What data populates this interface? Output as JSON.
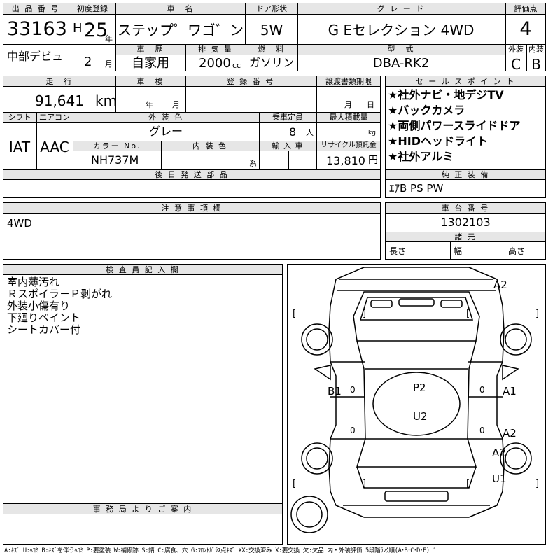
{
  "header": {
    "lot_label": "出 品 番 号",
    "lot_number": "33163",
    "debut_label": "中部デビュ",
    "first_reg_label": "初度登録",
    "era": "H",
    "year": "25",
    "year_unit": "年",
    "month": "2",
    "month_unit": "月",
    "car_name_label": "車　名",
    "car_name": "ステップ゜ワゴ゛ン",
    "door_label": "ドア形状",
    "door": "5W",
    "grade_label": "グ レ ー ド",
    "grade": "G Eセレクション 4WD",
    "score_label": "評価点",
    "score": "4",
    "history_label": "車　歴",
    "history": "自家用",
    "displacement_label": "排 気 量",
    "displacement": "2000",
    "cc": "cc",
    "fuel_label": "燃　料",
    "fuel": "ガソリン",
    "model_label": "型　式",
    "model": "DBA-RK2",
    "exterior_label": "外装",
    "exterior_grade": "C",
    "interior_label": "内装",
    "interior_grade": "B"
  },
  "spec": {
    "mileage_label": "走　行",
    "mileage": "91,641",
    "km": "km",
    "inspection_label": "車　検",
    "year_unit": "年",
    "month_unit": "月",
    "reg_number_label": "登 録 番 号",
    "transfer_label": "譲渡書類期限",
    "shift_label": "シフト",
    "ac_label": "エアコン",
    "shift": "IAT",
    "ac": "AAC",
    "exterior_color_label": "外 装 色",
    "exterior_color": "グレー",
    "capacity_label": "乗車定員",
    "capacity": "8",
    "capacity_unit": "人",
    "max_load_label": "最大積載量",
    "kg": "kg",
    "color_no_label": "カラー No.",
    "color_no": "NH737M",
    "interior_color_label": "内 装 色",
    "interior_suffix": "系",
    "import_label": "輸 入 車",
    "recycle_label": "リサイクル預託金",
    "recycle_fee": "13,810",
    "yen": "円",
    "later_parts_label": "後 日 発 送 部 品"
  },
  "sales_points": {
    "label": "セ ー ル ス ポ イ ン ト",
    "items": [
      "★社外ナビ・地デジTV",
      "★バックカメラ",
      "★両側パワースライドドア",
      "★HIDヘッドライト",
      "★社外アルミ"
    ]
  },
  "equipment": {
    "label": "純 正 装 備",
    "value": "ｴｱB PS PW"
  },
  "notes": {
    "label": "注 意 事 項 欄",
    "text": "4WD"
  },
  "chassis": {
    "label": "車 台 番 号",
    "number": "1302103",
    "dims_label": "諸 元",
    "length_label": "長さ",
    "width_label": "幅",
    "height_label": "高さ"
  },
  "inspector": {
    "label": "検 査 員 記 入 欄",
    "lines": [
      "室内薄汚れ",
      "Ｒスポイラ－Ｐ剥がれ",
      "外装小傷有り",
      "下廻りペイント",
      "シートカバー付"
    ]
  },
  "office": {
    "label": "事 務 局 よ り ご 案 内"
  },
  "diagram": {
    "bracket_open": "[",
    "bracket_close": "]",
    "marks": {
      "front_bumper": "A2",
      "left_door": "B1",
      "roof_center": "P2",
      "roof_lower": "U2",
      "right_front_door": "A1",
      "right_rear_door": "A2",
      "right_rear_quarter": "A2",
      "right_rear_lower": "U1"
    },
    "zero": "0"
  },
  "legend": {
    "text": "A:ｷｽﾞ U:ﾍｺﾐ B:ｷｽﾞを伴うﾍｺﾐ P:要塗装 W:補修跡 S:錆 C:腐食、穴 G:ﾌﾛﾝﾄｶﾞﾗｽ点ｷｽﾞ XX:交換済み X:要交換 欠:欠品 内・外装評価 5段階ﾗﾝｸ順(A･B･C･D･E) 1"
  }
}
